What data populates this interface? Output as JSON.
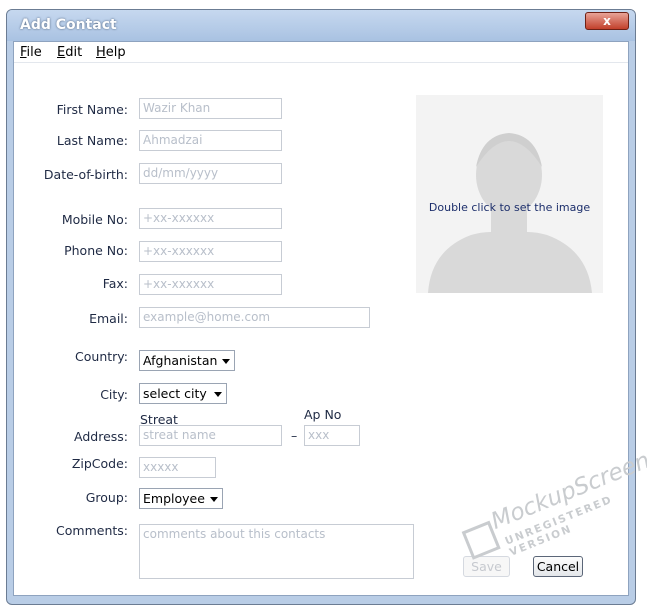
{
  "window": {
    "title": "Add Contact",
    "close_glyph": "x"
  },
  "menu": [
    {
      "mnemonic": "F",
      "rest": "ile"
    },
    {
      "mnemonic": "E",
      "rest": "dit"
    },
    {
      "mnemonic": "H",
      "rest": "elp"
    }
  ],
  "form": {
    "first_name": {
      "label": "First Name:",
      "placeholder": "Wazir Khan"
    },
    "last_name": {
      "label": "Last Name:",
      "placeholder": "Ahmadzai"
    },
    "dob": {
      "label": "Date-of-birth:",
      "placeholder": "dd/mm/yyyy"
    },
    "mobile": {
      "label": "Mobile No:",
      "placeholder": "+xx-xxxxxx"
    },
    "phone": {
      "label": "Phone No:",
      "placeholder": "+xx-xxxxxx"
    },
    "fax": {
      "label": "Fax:",
      "placeholder": "+xx-xxxxxx"
    },
    "email": {
      "label": "Email:",
      "placeholder": "example@home.com"
    },
    "country": {
      "label": "Country:",
      "value": "Afghanistan"
    },
    "city": {
      "label": "City:",
      "value": "select city"
    },
    "address": {
      "label": "Address:",
      "street_label": "Streat",
      "street_placeholder": "streat name",
      "separator": "–",
      "apt_label": "Ap No",
      "apt_placeholder": "xxx"
    },
    "zipcode": {
      "label": "ZipCode:",
      "placeholder": "xxxxx"
    },
    "group": {
      "label": "Group:",
      "value": "Employee"
    },
    "comments": {
      "label": "Comments:",
      "placeholder": "comments about this contacts"
    }
  },
  "photo": {
    "hint": "Double click to set the image"
  },
  "buttons": {
    "save": "Save",
    "cancel": "Cancel"
  },
  "watermark": {
    "line1": "MockupScreens",
    "line2": "UNREGISTERED VERSION"
  }
}
